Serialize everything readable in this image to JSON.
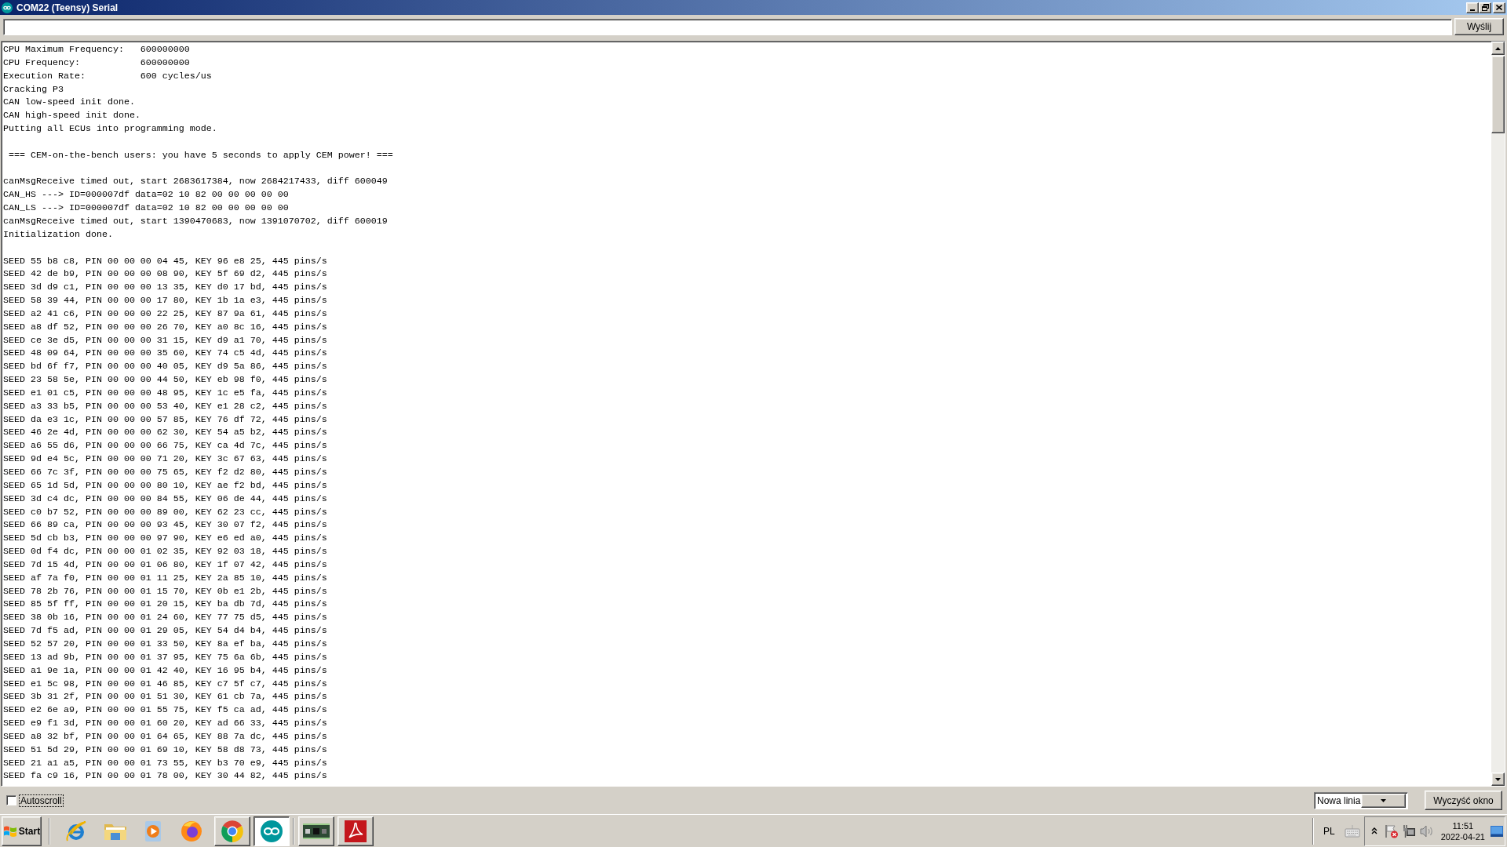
{
  "window": {
    "title": "COM22 (Teensy) Serial"
  },
  "send_bar": {
    "button": "Wyślij"
  },
  "output": {
    "blocks": [
      {
        "lines": [
          "CPU Maximum Frequency:   600000000",
          "CPU Frequency:           600000000",
          "Execution Rate:          600 cycles/us",
          "Cracking P3",
          "CAN low-speed init done.",
          "CAN high-speed init done.",
          "Putting all ECUs into programming mode."
        ]
      },
      {
        "lines": [
          " === CEM-on-the-bench users: you have 5 seconds to apply CEM power! ==="
        ]
      },
      {
        "lines": [
          "canMsgReceive timed out, start 2683617384, now 2684217433, diff 600049",
          "CAN_HS ---> ID=000007df data=02 10 82 00 00 00 00 00",
          "CAN_LS ---> ID=000007df data=02 10 82 00 00 00 00 00",
          "canMsgReceive timed out, start 1390470683, now 1391070702, diff 600019",
          "Initialization done."
        ]
      },
      {
        "lines": [
          "SEED 55 b8 c8, PIN 00 00 00 04 45, KEY 96 e8 25, 445 pins/s",
          "SEED 42 de b9, PIN 00 00 00 08 90, KEY 5f 69 d2, 445 pins/s",
          "SEED 3d d9 c1, PIN 00 00 00 13 35, KEY d0 17 bd, 445 pins/s",
          "SEED 58 39 44, PIN 00 00 00 17 80, KEY 1b 1a e3, 445 pins/s",
          "SEED a2 41 c6, PIN 00 00 00 22 25, KEY 87 9a 61, 445 pins/s",
          "SEED a8 df 52, PIN 00 00 00 26 70, KEY a0 8c 16, 445 pins/s",
          "SEED ce 3e d5, PIN 00 00 00 31 15, KEY d9 a1 70, 445 pins/s",
          "SEED 48 09 64, PIN 00 00 00 35 60, KEY 74 c5 4d, 445 pins/s",
          "SEED bd 6f f7, PIN 00 00 00 40 05, KEY d9 5a 86, 445 pins/s",
          "SEED 23 58 5e, PIN 00 00 00 44 50, KEY eb 98 f0, 445 pins/s",
          "SEED e1 01 c5, PIN 00 00 00 48 95, KEY 1c e5 fa, 445 pins/s",
          "SEED a3 33 b5, PIN 00 00 00 53 40, KEY e1 28 c2, 445 pins/s",
          "SEED da e3 1c, PIN 00 00 00 57 85, KEY 76 df 72, 445 pins/s",
          "SEED 46 2e 4d, PIN 00 00 00 62 30, KEY 54 a5 b2, 445 pins/s",
          "SEED a6 55 d6, PIN 00 00 00 66 75, KEY ca 4d 7c, 445 pins/s",
          "SEED 9d e4 5c, PIN 00 00 00 71 20, KEY 3c 67 63, 445 pins/s",
          "SEED 66 7c 3f, PIN 00 00 00 75 65, KEY f2 d2 80, 445 pins/s",
          "SEED 65 1d 5d, PIN 00 00 00 80 10, KEY ae f2 bd, 445 pins/s",
          "SEED 3d c4 dc, PIN 00 00 00 84 55, KEY 06 de 44, 445 pins/s",
          "SEED c0 b7 52, PIN 00 00 00 89 00, KEY 62 23 cc, 445 pins/s",
          "SEED 66 89 ca, PIN 00 00 00 93 45, KEY 30 07 f2, 445 pins/s",
          "SEED 5d cb b3, PIN 00 00 00 97 90, KEY e6 ed a0, 445 pins/s",
          "SEED 0d f4 dc, PIN 00 00 01 02 35, KEY 92 03 18, 445 pins/s",
          "SEED 7d 15 4d, PIN 00 00 01 06 80, KEY 1f 07 42, 445 pins/s",
          "SEED af 7a f0, PIN 00 00 01 11 25, KEY 2a 85 10, 445 pins/s",
          "SEED 78 2b 76, PIN 00 00 01 15 70, KEY 0b e1 2b, 445 pins/s",
          "SEED 85 5f ff, PIN 00 00 01 20 15, KEY ba db 7d, 445 pins/s",
          "SEED 38 0b 16, PIN 00 00 01 24 60, KEY 77 75 d5, 445 pins/s",
          "SEED 7d f5 ad, PIN 00 00 01 29 05, KEY 54 d4 b4, 445 pins/s",
          "SEED 52 57 20, PIN 00 00 01 33 50, KEY 8a ef ba, 445 pins/s",
          "SEED 13 ad 9b, PIN 00 00 01 37 95, KEY 75 6a 6b, 445 pins/s",
          "SEED a1 9e 1a, PIN 00 00 01 42 40, KEY 16 95 b4, 445 pins/s",
          "SEED e1 5c 98, PIN 00 00 01 46 85, KEY c7 5f c7, 445 pins/s",
          "SEED 3b 31 2f, PIN 00 00 01 51 30, KEY 61 cb 7a, 445 pins/s",
          "SEED e2 6e a9, PIN 00 00 01 55 75, KEY f5 ca ad, 445 pins/s",
          "SEED e9 f1 3d, PIN 00 00 01 60 20, KEY ad 66 33, 445 pins/s",
          "SEED a8 32 bf, PIN 00 00 01 64 65, KEY 88 7a dc, 445 pins/s",
          "SEED 51 5d 29, PIN 00 00 01 69 10, KEY 58 d8 73, 445 pins/s",
          "SEED 21 a1 a5, PIN 00 00 01 73 55, KEY b3 70 e9, 445 pins/s",
          "SEED fa c9 16, PIN 00 00 01 78 00, KEY 30 44 82, 445 pins/s"
        ]
      }
    ]
  },
  "bottom_bar": {
    "autoscroll": {
      "label": "Autoscroll",
      "checked": false
    },
    "line_ending": {
      "value": "Nowa linia"
    },
    "clear_button": "Wyczyść okno"
  },
  "taskbar": {
    "start": "Start",
    "tasks": [
      {
        "selected": false
      },
      {
        "selected": true
      },
      {
        "selected": false
      },
      {
        "selected": false
      }
    ],
    "language": "PL",
    "clock": {
      "time": "11:51",
      "date": "2022-04-21"
    }
  }
}
